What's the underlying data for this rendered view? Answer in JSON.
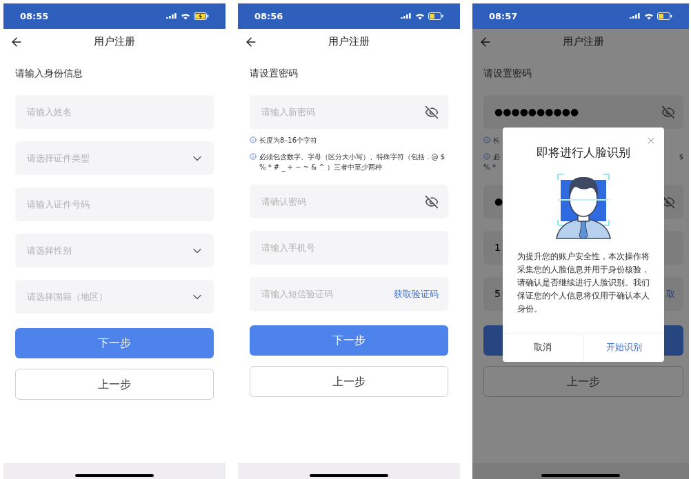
{
  "screens": [
    {
      "dimmed": false,
      "status_bar": {
        "time": "08:55",
        "charging": true
      },
      "nav": {
        "title": "用户注册"
      },
      "section_title": "请输入身份信息",
      "fields": [
        {
          "kind": "text",
          "placeholder": "请输入姓名"
        },
        {
          "kind": "select",
          "placeholder": "请选择证件类型"
        },
        {
          "kind": "text",
          "placeholder": "请输入证件号码"
        },
        {
          "kind": "select",
          "placeholder": "请选择性别"
        },
        {
          "kind": "select",
          "placeholder": "请选择国籍（地区）"
        }
      ],
      "buttons": [
        {
          "kind": "primary",
          "label": "下一步"
        },
        {
          "kind": "secondary",
          "label": "上一步"
        }
      ]
    },
    {
      "dimmed": false,
      "status_bar": {
        "time": "08:56",
        "charging": false
      },
      "nav": {
        "title": "用户注册"
      },
      "section_title": "请设置密码",
      "fields": [
        {
          "kind": "password",
          "placeholder": "请输入新密码"
        },
        {
          "kind": "note",
          "text": "长度为8–16个字符"
        },
        {
          "kind": "note",
          "text": "必须包含数字、字母（区分大小写）、特殊字符（包括 . @ $ % * # _ + − ~ & ^ ）三者中至少两种"
        },
        {
          "kind": "password",
          "placeholder": "请确认密码"
        },
        {
          "kind": "text",
          "placeholder": "请输入手机号"
        },
        {
          "kind": "sms",
          "placeholder": "请输入短信验证码",
          "action": "获取验证码"
        }
      ],
      "buttons": [
        {
          "kind": "primary",
          "label": "下一步"
        },
        {
          "kind": "secondary",
          "label": "上一步"
        }
      ]
    },
    {
      "dimmed": true,
      "status_bar": {
        "time": "08:57",
        "charging": false
      },
      "nav": {
        "title": "用户注册"
      },
      "section_title": "请设置密码",
      "fields": [
        {
          "kind": "password",
          "value": "●●●●●●●●●●"
        },
        {
          "kind": "note",
          "text": "长"
        },
        {
          "kind": "note",
          "text": "必",
          "tail": "$",
          "continuation": "% *"
        },
        {
          "kind": "password",
          "value": "●"
        },
        {
          "kind": "text",
          "value": "1"
        },
        {
          "kind": "sms",
          "value": "5",
          "action": "取"
        }
      ],
      "buttons": [
        {
          "kind": "primary"
        },
        {
          "kind": "secondary",
          "label": "上一步"
        }
      ],
      "dialog": {
        "title": "即将进行人脸识别",
        "message": "为提升您的账户安全性，本次操作将采集您的人脸信息并用于身份核验，请确认是否继续进行人脸识别。我们保证您的个人信息将仅用于确认本人身份。",
        "buttons": [
          {
            "kind": "cancel",
            "label": "取消"
          },
          {
            "kind": "confirm",
            "label": "开始识别"
          }
        ]
      }
    }
  ]
}
